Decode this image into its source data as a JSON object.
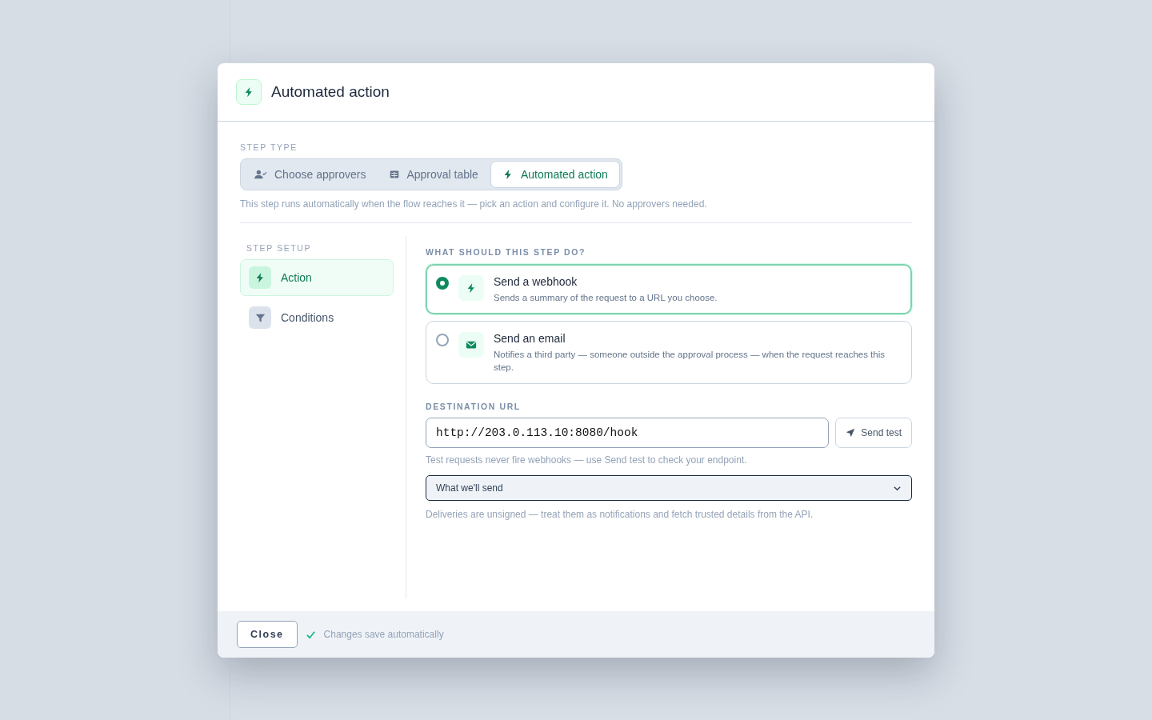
{
  "dialog": {
    "title": "Automated action"
  },
  "step_type": {
    "label": "STEP TYPE",
    "tabs": [
      {
        "label": "Choose approvers",
        "kind": "approvers",
        "selected": false
      },
      {
        "label": "Approval table",
        "kind": "table",
        "selected": false
      },
      {
        "label": "Automated action",
        "kind": "automation",
        "selected": true
      }
    ],
    "hint": "This step runs automatically when the flow reaches it — pick an action and configure it. No approvers needed."
  },
  "step_setup": {
    "label": "STEP SETUP",
    "items": [
      {
        "label": "Action",
        "kind": "action",
        "selected": true
      },
      {
        "label": "Conditions",
        "kind": "conditions",
        "selected": false
      }
    ]
  },
  "action": {
    "label": "WHAT SHOULD THIS STEP DO?",
    "options": [
      {
        "title": "Send a webhook",
        "description": "Sends a summary of the request to a URL you choose.",
        "kind": "webhook",
        "selected": true
      },
      {
        "title": "Send an email",
        "description": "Notifies a third party — someone outside the approval process — when the request reaches this step.",
        "kind": "email",
        "selected": false
      }
    ]
  },
  "destination": {
    "label": "DESTINATION URL",
    "value": "http://203.0.113.10:8080/hook",
    "button": "Send test",
    "hint": "Test requests never fire webhooks — use Send test to check your endpoint.",
    "dropdown": "What we'll send",
    "note": "Deliveries are unsigned — treat them as notifications and fetch trusted details from the API."
  },
  "footer": {
    "close": "Close",
    "status": "Changes save automatically"
  }
}
